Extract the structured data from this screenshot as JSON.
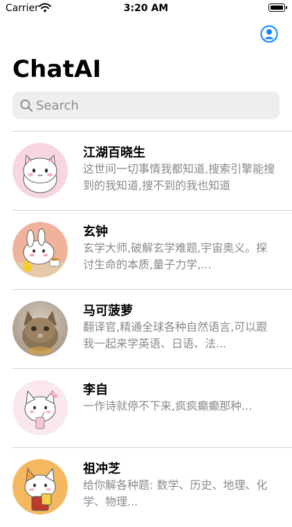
{
  "status_bar": {
    "carrier": "Carrier",
    "time": "3:20 AM"
  },
  "header": {
    "title": "ChatAI"
  },
  "search": {
    "placeholder": "Search",
    "value": ""
  },
  "colors": {
    "accent": "#0a84ff",
    "search_bg": "#eeeeef",
    "secondary_text": "#8a8a8e"
  },
  "chats": [
    {
      "name": "江湖百晓生",
      "description": "这世间一切事情我都知道,搜索引擎能搜到的我知道,搜不到的我也知道",
      "avatar": "white-cat-icon"
    },
    {
      "name": "玄钟",
      "description": "玄学大师,破解玄学难题,宇宙奥义。探讨生命的本质,量子力学,...",
      "avatar": "rabbit-with-duck-icon"
    },
    {
      "name": "马可菠萝",
      "description": "翻译官,精通全球各种自然语言,可以跟我一起来学英语、日语、法...",
      "avatar": "kitten-photo"
    },
    {
      "name": "李自",
      "description": "一作诗就停不下来,疯疯癫癫那种...",
      "avatar": "cat-with-drink-icon"
    },
    {
      "name": "祖冲芝",
      "description": "给你解各种题: 数学、历史、地理、化学、物理...",
      "avatar": "cat-with-fan-icon"
    }
  ]
}
